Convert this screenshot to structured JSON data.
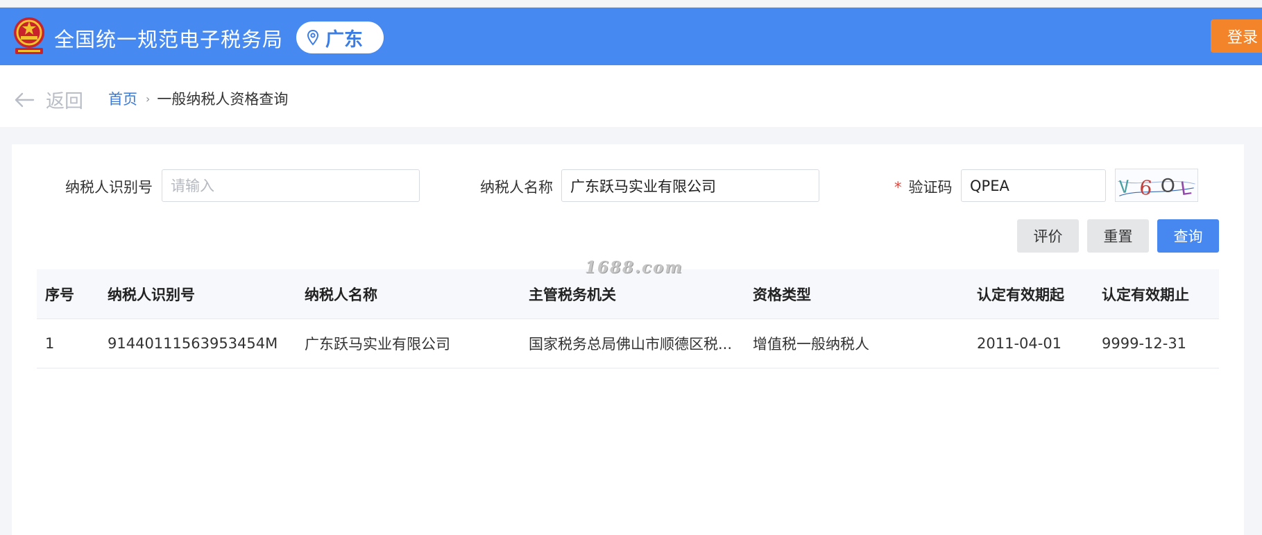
{
  "header": {
    "site_title": "全国统一规范电子税务局",
    "region": "广东",
    "login_label": "登录",
    "emblem_icon": "national-emblem-icon",
    "accent_color": "#4689f1"
  },
  "nav": {
    "back_label": "返回",
    "breadcrumb": {
      "home": "首页",
      "separator": "›",
      "current": "一般纳税人资格查询"
    }
  },
  "form": {
    "taxpayer_id": {
      "label": "纳税人识别号",
      "value": "",
      "placeholder": "请输入"
    },
    "taxpayer_name": {
      "label": "纳税人名称",
      "value": "广东跃马实业有限公司",
      "placeholder": ""
    },
    "captcha": {
      "required_mark": "*",
      "label": "验证码",
      "value": "QPEA",
      "image_text": "V6OL"
    },
    "buttons": {
      "evaluate": "评价",
      "reset": "重置",
      "query": "查询"
    }
  },
  "watermark": "1688.com",
  "table": {
    "columns": [
      "序号",
      "纳税人识别号",
      "纳税人名称",
      "主管税务机关",
      "资格类型",
      "认定有效期起",
      "认定有效期止"
    ],
    "rows": [
      [
        "1",
        "91440111563953454M",
        "广东跃马实业有限公司",
        "国家税务总局佛山市顺德区税...",
        "增值税一般纳税人",
        "2011-04-01",
        "9999-12-31"
      ]
    ]
  }
}
